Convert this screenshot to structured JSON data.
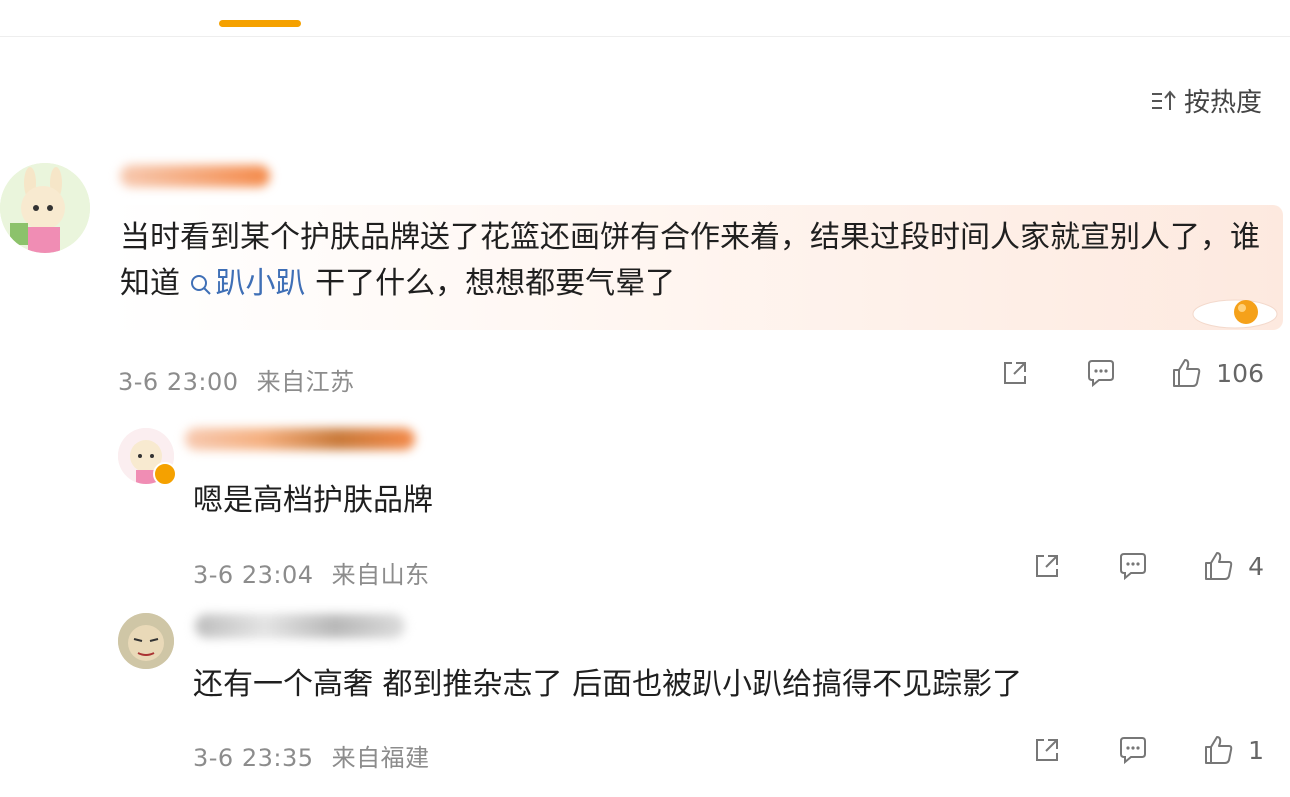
{
  "sort": {
    "label": "按热度"
  },
  "comments": [
    {
      "text_a": "当时看到某个护肤品牌送了花篮还画饼有合作来着，结果过段时间人家就宣别人了，谁知道",
      "topic": "趴小趴",
      "text_b": " 干了什么，想想都要气晕了",
      "time": "3-6 23:00",
      "location": "来自江苏",
      "likes": "106"
    },
    {
      "text": "嗯是高档护肤品牌",
      "time": "3-6 23:04",
      "location": "来自山东",
      "likes": "4"
    },
    {
      "text": "还有一个高奢 都到推杂志了 后面也被趴小趴给搞得不见踪影了",
      "time": "3-6 23:35",
      "location": "来自福建",
      "likes": "1"
    }
  ],
  "colors": {
    "accent": "#f5a100",
    "link": "#3f6fb6",
    "meta": "#8c8c8c"
  },
  "icons": [
    "sort-icon",
    "search-icon",
    "share-icon",
    "comment-icon",
    "like-icon"
  ]
}
